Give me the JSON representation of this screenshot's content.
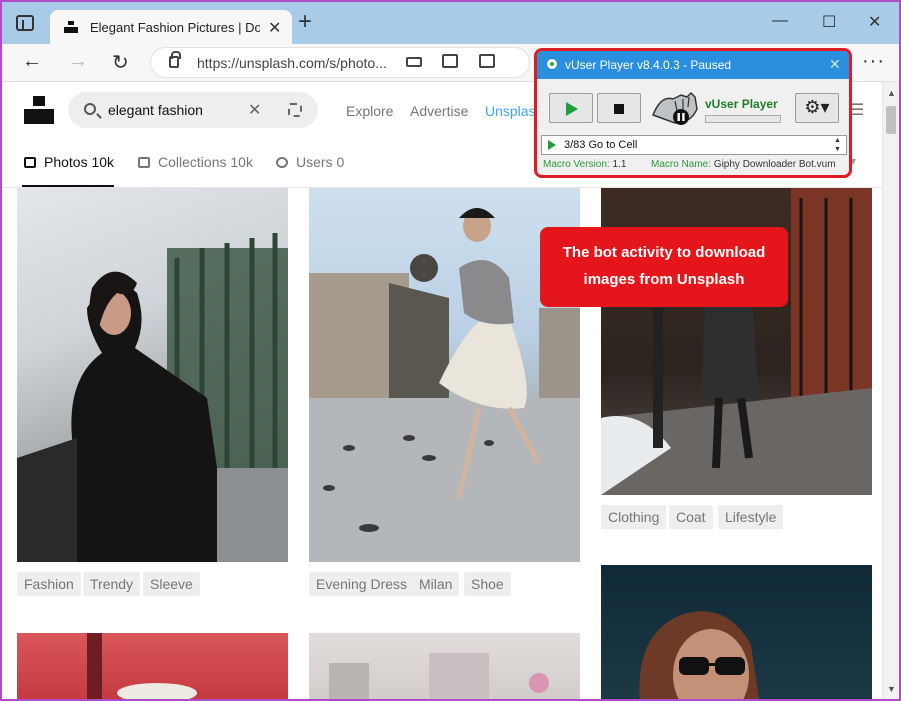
{
  "browser": {
    "tab_title": "Elegant Fashion Pictures | Downl",
    "tab_close": "✕",
    "new_tab": "+",
    "window_controls": {
      "minimize": "—",
      "maximize": "☐",
      "close": "✕"
    },
    "back": "←",
    "forward": "→",
    "reload": "↻",
    "url": "https://unsplash.com/s/photo...",
    "menu": "···"
  },
  "unsplash": {
    "search_value": "elegant fashion",
    "search_clear": "✕",
    "nav": {
      "explore": "Explore",
      "advertise": "Advertise",
      "plus": "Unsplash"
    },
    "tabs": {
      "photos": "Photos 10k",
      "collections": "Collections 10k",
      "users": "Users 0"
    },
    "col1_tags": [
      "Fashion",
      "Trendy",
      "Sleeve"
    ],
    "col2_tags": [
      "Evening Dress",
      "Milan",
      "Shoe"
    ],
    "col3_tags": [
      "Clothing",
      "Coat",
      "Lifestyle"
    ]
  },
  "vuser": {
    "title": "vUser Player v8.4.0.3 - Paused",
    "close": "✕",
    "brand": "vUser Player",
    "gear": "⚙▾",
    "step": "3/83 Go to Cell",
    "macro_version_label": "Macro Version:",
    "macro_version": "1.1",
    "macro_name_label": "Macro Name:",
    "macro_name": "Giphy Downloader Bot.vum"
  },
  "callout": {
    "line1": "The bot activity to download",
    "line2": "images from Unsplash"
  },
  "colors": {
    "frame": "#b04cc8",
    "tabstrip": "#a8cce8",
    "vuser_title": "#2b8fdf",
    "callout": "#e4161c",
    "link_blue": "#3ea3ff"
  }
}
